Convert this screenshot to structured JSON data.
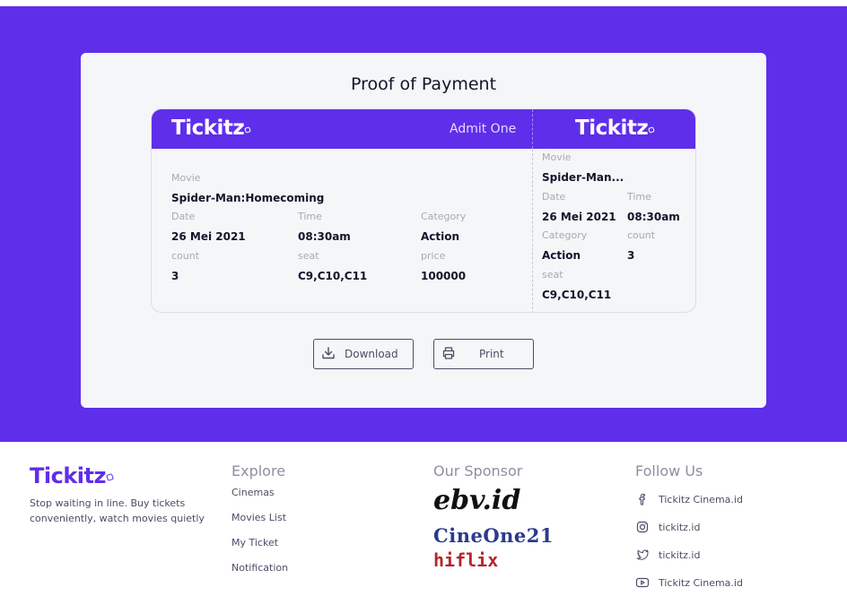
{
  "brand": {
    "name": "Tickitz"
  },
  "card": {
    "title": "Proof of Payment"
  },
  "ticket": {
    "admit": "Admit One",
    "main": {
      "movie_label": "Movie",
      "movie": "Spider-Man:Homecoming",
      "date_label": "Date",
      "date": "26 Mei 2021",
      "time_label": "Time",
      "time": "08:30am",
      "category_label": "Category",
      "category": "Action",
      "count_label": "count",
      "count": "3",
      "seat_label": "seat",
      "seat": "C9,C10,C11",
      "price_label": "price",
      "price": "100000"
    },
    "stub": {
      "movie_label": "Movie",
      "movie": "Spider-Man...",
      "date_label": "Date",
      "date": "26 Mei 2021",
      "time_label": "Time",
      "time": "08:30am",
      "category_label": "Category",
      "category": "Action",
      "count_label": "count",
      "count": "3",
      "seat_label": "seat",
      "seat": "C9,C10,C11"
    }
  },
  "actions": {
    "download": "Download",
    "print": "Print"
  },
  "footer": {
    "tagline": "Stop waiting in line. Buy tickets conveniently, watch movies quietly",
    "explore_title": "Explore",
    "explore": [
      "Cinemas",
      "Movies List",
      "My Ticket",
      "Notification"
    ],
    "sponsor_title": "Our Sponsor",
    "sponsors": [
      "ebv.id",
      "CineOne21",
      "hiflix"
    ],
    "follow_title": "Follow Us",
    "socials": [
      {
        "icon": "facebook-icon",
        "label": "Tickitz Cinema.id"
      },
      {
        "icon": "instagram-icon",
        "label": "tickitz.id"
      },
      {
        "icon": "twitter-icon",
        "label": "tickitz.id"
      },
      {
        "icon": "youtube-icon",
        "label": "Tickitz Cinema.id"
      }
    ]
  },
  "colors": {
    "primary": "#5f2eea",
    "card": "#f5f6f8",
    "cineone": "#2b3a8c",
    "hiflix": "#b3262b"
  }
}
